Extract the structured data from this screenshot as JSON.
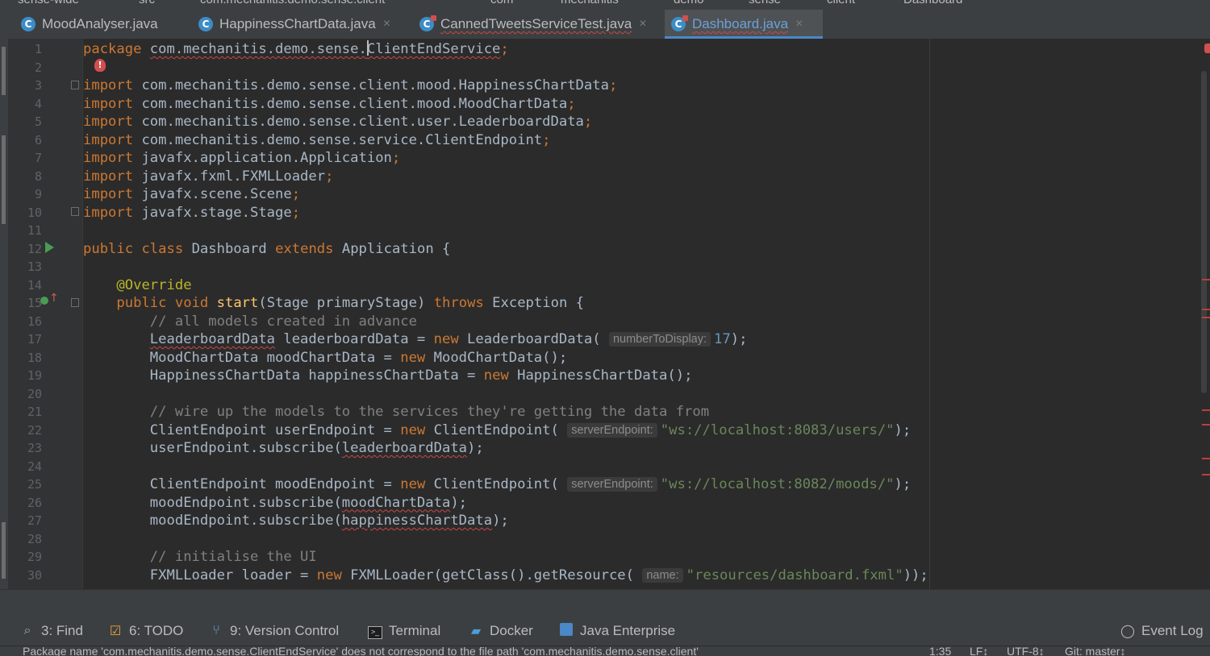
{
  "breadcrumbs": [
    "sense-wide",
    "src",
    "com.mechanitis.demo.sense.client",
    "com",
    "mechanitis",
    "demo",
    "sense",
    "client",
    "Dashboard"
  ],
  "tabs": [
    {
      "label": "MoodAnalyser.java",
      "icon": "class-icon",
      "closable": false,
      "active": false
    },
    {
      "label": "HappinessChartData.java",
      "icon": "class-icon",
      "closable": true,
      "active": false
    },
    {
      "label": "CannedTweetsServiceTest.java",
      "icon": "test-class-icon",
      "closable": true,
      "active": false
    },
    {
      "label": "Dashboard.java",
      "icon": "runnable-class-icon",
      "closable": true,
      "active": true
    }
  ],
  "editor": {
    "line_numbers": [
      "1",
      "2",
      "3",
      "4",
      "5",
      "6",
      "7",
      "8",
      "9",
      "10",
      "11",
      "12",
      "13",
      "14",
      "15",
      "16",
      "17",
      "18",
      "19",
      "20",
      "21",
      "22",
      "23",
      "24",
      "25",
      "26",
      "27",
      "28",
      "29",
      "30"
    ],
    "lines": {
      "l1_kw": "package",
      "l1_pkg_a": "com.mechanitis.demo.sense.",
      "l1_pkg_b": "ClientEndService",
      "l1_semi": ";",
      "import_kw": "import",
      "l3": "com.mechanitis.demo.sense.client.mood.HappinessChartData",
      "l4": "com.mechanitis.demo.sense.client.mood.MoodChartData",
      "l5": "com.mechanitis.demo.sense.client.user.LeaderboardData",
      "l6": "com.mechanitis.demo.sense.service.ClientEndpoint",
      "l7": "javafx.application.Application",
      "l8": "javafx.fxml.FXMLLoader",
      "l9": "javafx.scene.Scene",
      "l10": "javafx.stage.Stage",
      "l12_public": "public",
      "l12_class": "class",
      "l12_name": "Dashboard",
      "l12_extends": "extends",
      "l12_super": "Application {",
      "l14": "@Override",
      "l15_public": "public",
      "l15_void": "void",
      "l15_method": "start",
      "l15_params": "(Stage primaryStage)",
      "l15_throws": "throws",
      "l15_exc": "Exception {",
      "l16": "// all models created in advance",
      "l17_a": "LeaderboardData",
      "l17_b": " leaderboardData = ",
      "l17_new": "new",
      "l17_c": " LeaderboardData(",
      "l17_hint": "numberToDisplay:",
      "l17_num": "17",
      "l17_d": ");",
      "l18_a": "MoodChartData moodChartData = ",
      "l18_b": " MoodChartData();",
      "l19_a": "HappinessChartData happinessChartData = ",
      "l19_b": " HappinessChartData();",
      "l21": "// wire up the models to the services they're getting the data from",
      "l22_a": "ClientEndpoint userEndpoint = ",
      "l22_b": " ClientEndpoint(",
      "l22_hint": "serverEndpoint:",
      "l22_str": "\"ws://localhost:8083/users/\"",
      "l22_c": ");",
      "l23_a": "userEndpoint.subscribe(",
      "l23_b": "leaderboardData",
      "l23_c": ");",
      "l25_a": "ClientEndpoint moodEndpoint = ",
      "l25_b": " ClientEndpoint(",
      "l25_hint": "serverEndpoint:",
      "l25_str": "\"ws://localhost:8082/moods/\"",
      "l25_c": ");",
      "l26_a": "moodEndpoint.subscribe(",
      "l26_b": "moodChartData",
      "l26_c": ");",
      "l27_a": "moodEndpoint.subscribe(",
      "l27_b": "happinessChartData",
      "l27_c": ");",
      "l29": "// initialise the UI",
      "l30_a": "FXMLLoader loader = ",
      "l30_b": " FXMLLoader(getClass().getResource(",
      "l30_hint": "name:",
      "l30_str": "\"resources/dashboard.fxml\"",
      "l30_c": "));",
      "new_kw": "new"
    }
  },
  "tool_windows": [
    {
      "label": "3: Find",
      "icon": "search-icon"
    },
    {
      "label": "6: TODO",
      "icon": "todo-icon"
    },
    {
      "label": "9: Version Control",
      "icon": "version-control-icon"
    },
    {
      "label": "Terminal",
      "icon": "terminal-icon"
    },
    {
      "label": "Docker",
      "icon": "docker-icon"
    },
    {
      "label": "Java Enterprise",
      "icon": "java-enterprise-icon"
    },
    {
      "label": "Event Log",
      "icon": "event-log-icon"
    }
  ],
  "status": {
    "message": "Package name 'com.mechanitis.demo.sense.ClientEndService' does not correspond to the file path 'com.mechanitis.demo.sense.client'",
    "position": "1:35",
    "line_sep": "LF↕",
    "encoding": "UTF-8↕",
    "vcs": "Git: master↕"
  },
  "colors": {
    "keyword": "#cc7832",
    "string": "#6a8759",
    "comment": "#808080",
    "annotation": "#bbb529",
    "method": "#ffc66d",
    "number": "#6897bb",
    "accent": "#4a88c7"
  }
}
